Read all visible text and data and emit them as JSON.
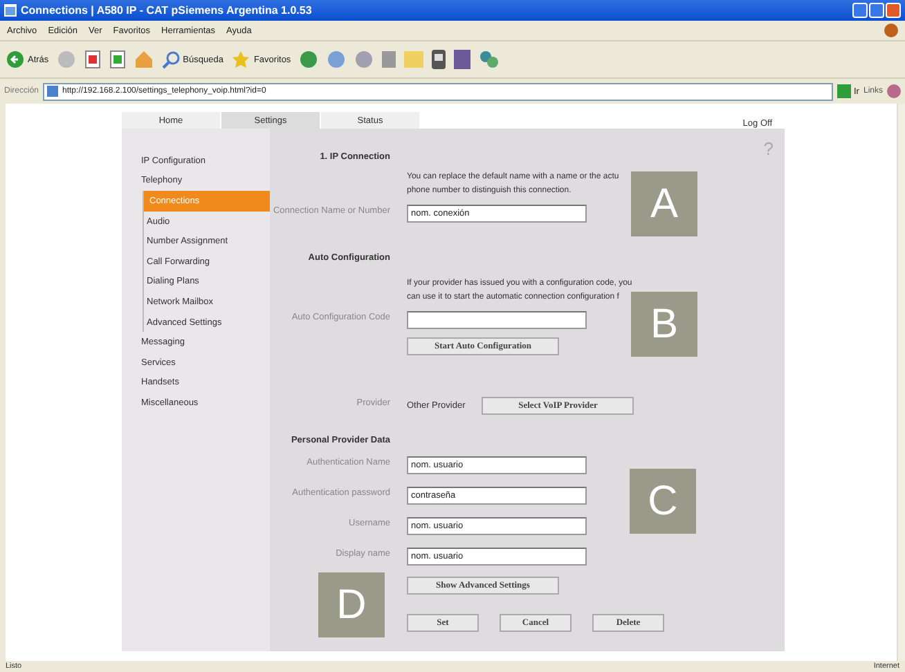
{
  "window": {
    "title": "Connections | A580 IP - CAT pSiemens Argentina 1.0.53"
  },
  "menu": [
    "Archivo",
    "Edición",
    "Ver",
    "Favoritos",
    "Herramientas",
    "Ayuda"
  ],
  "toolbar": {
    "back": "Atrás",
    "search": "Búsqueda",
    "favorites": "Favoritos"
  },
  "address": {
    "label": "Dirección",
    "url": "http://192.168.2.100/settings_telephony_voip.html?id=0",
    "go": "Ir",
    "links": "Links"
  },
  "tabs": [
    {
      "label": "Home",
      "selected": false
    },
    {
      "label": "Settings",
      "selected": true
    },
    {
      "label": "Status",
      "selected": false
    }
  ],
  "log_off": "Log Off",
  "help": "?",
  "sidebar": [
    {
      "label": "IP Configuration",
      "selected": false
    },
    {
      "label": "Telephony",
      "selected": false,
      "children": [
        {
          "label": "Connections",
          "selected": true
        },
        {
          "label": "Audio",
          "selected": false
        },
        {
          "label": "Number Assignment",
          "selected": false
        },
        {
          "label": "Call Forwarding",
          "selected": false
        },
        {
          "label": "Dialing Plans",
          "selected": false
        },
        {
          "label": "Network Mailbox",
          "selected": false
        },
        {
          "label": "Advanced Settings",
          "selected": false
        }
      ]
    },
    {
      "label": "Messaging",
      "selected": false
    },
    {
      "label": "Services",
      "selected": false
    },
    {
      "label": "Handsets",
      "selected": false
    },
    {
      "label": "Miscellaneous",
      "selected": false
    }
  ],
  "form": [
    {
      "kind": "heading",
      "label": "1. IP Connection"
    },
    {
      "kind": "note",
      "lines": [
        "You can replace the default name with a name or the actu",
        "phone number to distinguish this connection."
      ]
    },
    {
      "kind": "field",
      "label": "Connection Name or Number",
      "value": "nom. conexión"
    },
    {
      "kind": "heading",
      "label": "Auto Configuration"
    },
    {
      "kind": "note",
      "lines": [
        "If your provider has issued you with a configuration code, you",
        "can use it to start the automatic connection configuration f"
      ]
    },
    {
      "kind": "field",
      "label": "Auto Configuration Code"
    },
    {
      "kind": "button",
      "text": "Start Auto Configuration"
    },
    {
      "kind": "provider",
      "label": "Provider",
      "value": "Other Provider",
      "button": "Select VoIP Provider"
    },
    {
      "kind": "heading",
      "label": "Personal Provider Data"
    },
    {
      "kind": "field",
      "label": "Authentication Name",
      "value": "nom. usuario"
    },
    {
      "kind": "field",
      "label": "Authentication password",
      "value": "contraseña"
    },
    {
      "kind": "field",
      "label": "Username",
      "value": "nom. usuario"
    },
    {
      "kind": "field",
      "label": "Display name",
      "value": "nom. usuario"
    },
    {
      "kind": "button",
      "text": "Show Advanced Settings"
    },
    {
      "kind": "actions",
      "buttons": [
        "Set",
        "Cancel",
        "Delete"
      ]
    }
  ],
  "callouts": [
    "A",
    "B",
    "C",
    "D"
  ],
  "status_bar": {
    "left": "Listo",
    "right": "Internet"
  }
}
